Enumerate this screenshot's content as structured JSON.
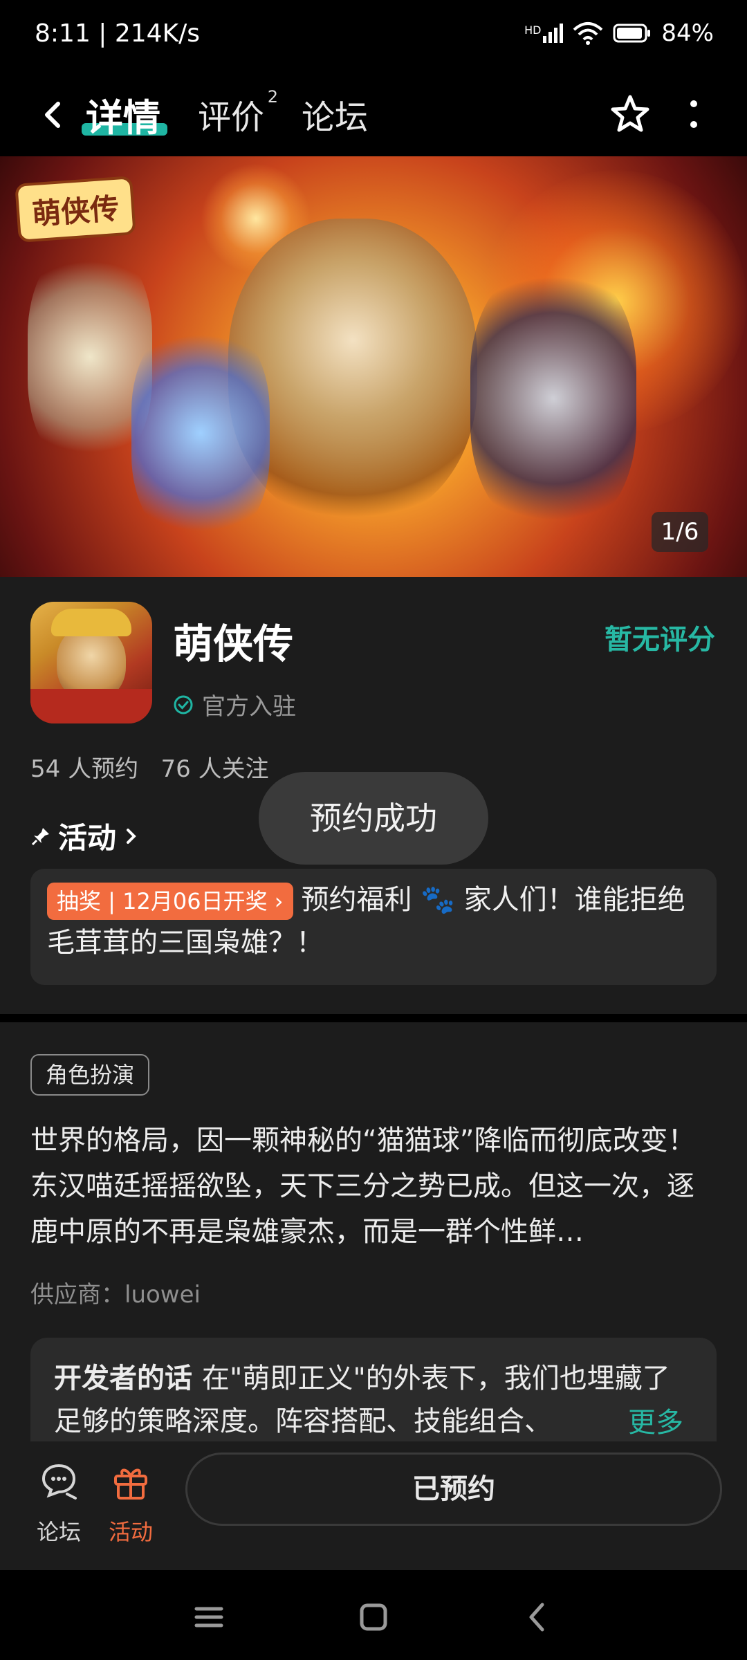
{
  "status_bar": {
    "time_speed": "8:11 | 214K/s",
    "network": "HD",
    "battery": "84%"
  },
  "nav": {
    "tabs": [
      {
        "label": "详情",
        "active": true
      },
      {
        "label": "评价",
        "sup": "2"
      },
      {
        "label": "论坛"
      }
    ],
    "icons": [
      "back-arrow-icon",
      "star-favorite-icon",
      "more-vertical-icon"
    ]
  },
  "banner": {
    "logo_text": "萌侠传",
    "counter": "1/6"
  },
  "app": {
    "name": "萌侠传",
    "official": "官方入驻",
    "rating": "暂无评分",
    "stats": "54 人预约   76 人关注"
  },
  "toast": "预约成功",
  "activity": {
    "title": "活动",
    "badge": "抽奖 | 12月06日开奖",
    "text_prefix": "预约福利",
    "text_body": "家人们！谁能拒绝毛茸茸的三国枭雄？！"
  },
  "genre_tag": "角色扮演",
  "description": "世界的格局，因一颗神秘的“猫猫球”降临而彻底改变！东汉喵廷摇摇欲坠，天下三分之势已成。但这一次，逐鹿中原的不再是枭雄豪杰，而是一群个性鲜…",
  "supplier": "供应商：luowei",
  "developer": {
    "label": "开发者的话",
    "text": "在\"萌即正义\"的外表下，我们也埋藏了足够的策略深度。阵容搭配、技能组合、",
    "more": "更多"
  },
  "bottom": {
    "forum_label": "论坛",
    "activity_label": "活动",
    "reserve_label": "已预约"
  },
  "colors": {
    "accent": "#1fb5a3",
    "orange": "#f26c3f"
  }
}
